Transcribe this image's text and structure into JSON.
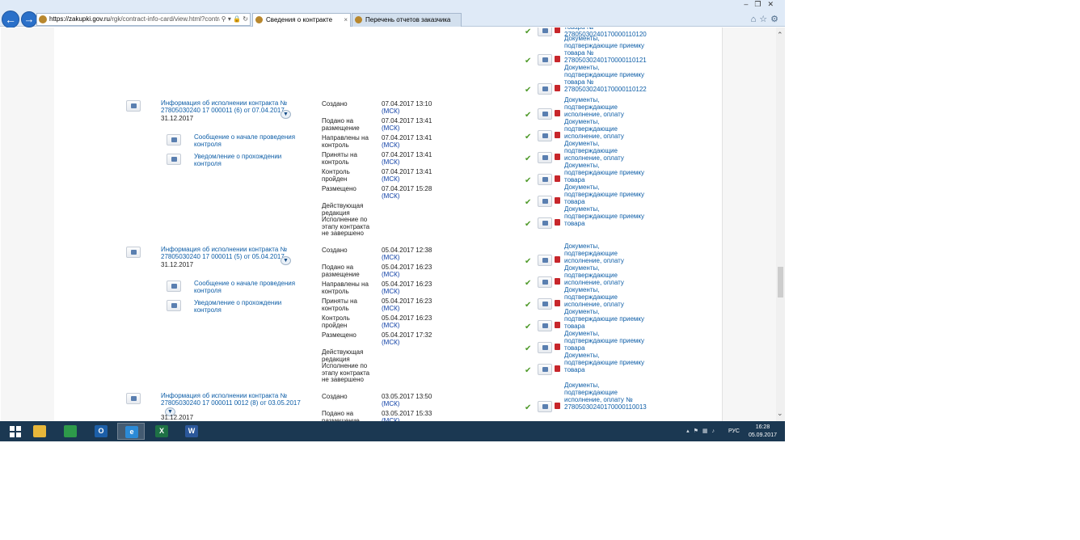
{
  "browser": {
    "url_host": "https://zakupki.gov.ru",
    "url_path": "/rgk/contract-info-card/view.html?contrac",
    "tabs": [
      {
        "label": "Сведения о контракте",
        "active": true
      },
      {
        "label": "Перечень отчетов заказчика",
        "active": false
      }
    ]
  },
  "top_docs": [
    {
      "lines": [
        "товара №",
        "27805030240170000110120"
      ],
      "clip": true
    },
    {
      "lines": [
        "Документы,",
        "подтверждающие приемку",
        "товара №",
        "27805030240170000110121"
      ]
    },
    {
      "lines": [
        "Документы,",
        "подтверждающие приемку",
        "товара №",
        "27805030240170000110122"
      ]
    }
  ],
  "blocks": [
    {
      "title": [
        "Информация об исполнении контракта №",
        "27805030240 17 000011 (6) от 07.04.2017"
      ],
      "date": "31.12.2017",
      "subs": [
        [
          "Сообщение о начале проведения",
          "контроля"
        ],
        [
          "Уведомление о прохождении",
          "контроля"
        ]
      ],
      "statuses": [
        {
          "label": [
            "Создано"
          ],
          "date": "07.04.2017 13:10",
          "tz": "(МСК)"
        },
        {
          "label": [
            "Подано на",
            "размещение"
          ],
          "date": "07.04.2017 13:41",
          "tz": "(МСК)"
        },
        {
          "label": [
            "Направлены на",
            "контроль"
          ],
          "date": "07.04.2017 13:41",
          "tz": "(МСК)"
        },
        {
          "label": [
            "Приняты на",
            "контроль"
          ],
          "date": "07.04.2017 13:41",
          "tz": "(МСК)"
        },
        {
          "label": [
            "Контроль",
            "пройден"
          ],
          "date": "07.04.2017 13:41",
          "tz": "(МСК)"
        },
        {
          "label": [
            "Размещено"
          ],
          "date": "07.04.2017 15:28",
          "tz": "(МСК)"
        },
        {
          "label": [
            "Действующая",
            "редакция"
          ],
          "date": "",
          "tz": ""
        },
        {
          "label": [
            "Исполнение по",
            "этапу контракта",
            "не завершено"
          ],
          "date": "",
          "tz": ""
        }
      ],
      "docs": [
        [
          "Документы,",
          "подтверждающие",
          "исполнение, оплату"
        ],
        [
          "Документы,",
          "подтверждающие",
          "исполнение, оплату"
        ],
        [
          "Документы,",
          "подтверждающие",
          "исполнение, оплату"
        ],
        [
          "Документы,",
          "подтверждающие приемку",
          "товара"
        ],
        [
          "Документы,",
          "подтверждающие приемку",
          "товара"
        ],
        [
          "Документы,",
          "подтверждающие приемку",
          "товара"
        ]
      ]
    },
    {
      "title": [
        "Информация об исполнении контракта №",
        "27805030240 17 000011 (5) от 05.04.2017"
      ],
      "date": "31.12.2017",
      "subs": [
        [
          "Сообщение о начале проведения",
          "контроля"
        ],
        [
          "Уведомление о прохождении",
          "контроля"
        ]
      ],
      "statuses": [
        {
          "label": [
            "Создано"
          ],
          "date": "05.04.2017 12:38",
          "tz": "(МСК)"
        },
        {
          "label": [
            "Подано на",
            "размещение"
          ],
          "date": "05.04.2017 16:23",
          "tz": "(МСК)"
        },
        {
          "label": [
            "Направлены на",
            "контроль"
          ],
          "date": "05.04.2017 16:23",
          "tz": "(МСК)"
        },
        {
          "label": [
            "Приняты на",
            "контроль"
          ],
          "date": "05.04.2017 16:23",
          "tz": "(МСК)"
        },
        {
          "label": [
            "Контроль",
            "пройден"
          ],
          "date": "05.04.2017 16:23",
          "tz": "(МСК)"
        },
        {
          "label": [
            "Размещено"
          ],
          "date": "05.04.2017 17:32",
          "tz": "(МСК)"
        },
        {
          "label": [
            "Действующая",
            "редакция"
          ],
          "date": "",
          "tz": ""
        },
        {
          "label": [
            "Исполнение по",
            "этапу контракта",
            "не завершено"
          ],
          "date": "",
          "tz": ""
        }
      ],
      "docs": [
        [
          "Документы,",
          "подтверждающие",
          "исполнение, оплату"
        ],
        [
          "Документы,",
          "подтверждающие",
          "исполнение, оплату"
        ],
        [
          "Документы,",
          "подтверждающие",
          "исполнение, оплату"
        ],
        [
          "Документы,",
          "подтверждающие приемку",
          "товара"
        ],
        [
          "Документы,",
          "подтверждающие приемку",
          "товара"
        ],
        [
          "Документы,",
          "подтверждающие приемку",
          "товара"
        ]
      ]
    },
    {
      "title": [
        "Информация об исполнении контракта №",
        "27805030240 17 000011 0012 (8) от 03.05.2017"
      ],
      "date": "31.12.2017",
      "subs": [],
      "statuses": [
        {
          "label": [
            "Создано"
          ],
          "date": "03.05.2017 13:50",
          "tz": "(МСК)"
        },
        {
          "label": [
            "Подано на",
            "размещение"
          ],
          "date": "03.05.2017 15:33",
          "tz": "(МСК)"
        }
      ],
      "docs": [
        [
          "Документы,",
          "подтверждающие",
          "исполнение, оплату №",
          "27805030240170000110013"
        ]
      ]
    }
  ],
  "taskbar": {
    "apps": [
      {
        "name": "file-explorer",
        "glyph": "",
        "color": "#e8b73a"
      },
      {
        "name": "chrome",
        "glyph": "",
        "color": "#2e9a4a"
      },
      {
        "name": "outlook",
        "glyph": "O",
        "color": "#1c5fa8"
      },
      {
        "name": "internet-explorer",
        "glyph": "e",
        "color": "#2b8ad6",
        "active": true
      },
      {
        "name": "excel",
        "glyph": "X",
        "color": "#1e7145"
      },
      {
        "name": "word",
        "glyph": "W",
        "color": "#2b579a"
      }
    ],
    "lang": "РУС",
    "time": "16:28",
    "date": "05.09.2017"
  },
  "colors": {
    "link": "#0e5ea7",
    "msk": "#0e3fa6",
    "check": "#4f9a2a",
    "pdf": "#c7262b",
    "taskbar": "#1b3852"
  }
}
